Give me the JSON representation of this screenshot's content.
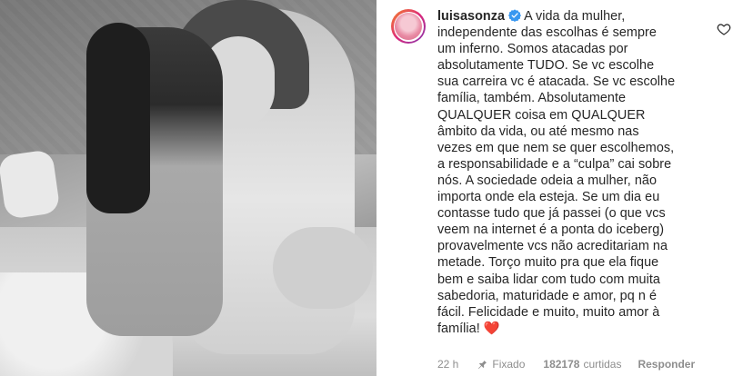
{
  "comment": {
    "username": "luisasonza",
    "verified": true,
    "text": "A vida da mulher,\nindependente das escolhas é sempre\num inferno. Somos atacadas por\nabsolutamente TUDO. Se vc escolhe\nsua carreira vc é atacada. Se vc escolhe\nfamília, também. Absolutamente\nQUALQUER coisa em QUALQUER\nâmbito da vida, ou até mesmo nas\nvezes em que nem se quer escolhemos,\na responsabilidade e a “culpa” cai sobre\nnós. A sociedade odeia a mulher, não\nimporta onde ela esteja. Se um dia eu\ncontasse tudo que já passei (o que vcs\nveem na internet é a ponta do iceberg)\nprovavelmente vcs não acreditariam na\nmetade. Torço muito pra que ela fique\nbem e saiba lidar com tudo com muita\nsabedoria, maturidade e amor, pq n é\nfácil. Felicidade e muito, muito amor à\nfamília!",
    "emoji": "❤️"
  },
  "meta": {
    "time": "22 h",
    "pinned": "Fixado",
    "likes_count": "182178",
    "likes_label": "curtidas",
    "reply": "Responder"
  },
  "icons": {
    "like": "heart-outline-icon",
    "pin": "pin-icon",
    "verified": "verified-badge-icon"
  },
  "colors": {
    "text": "#262626",
    "meta": "#8e8e8e",
    "verified": "#3897f0",
    "heart": "#d8203a"
  }
}
